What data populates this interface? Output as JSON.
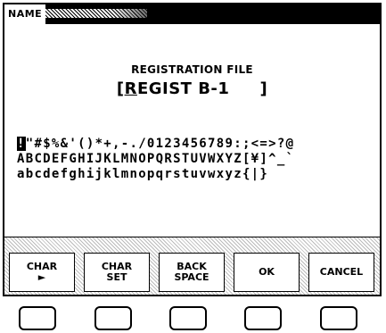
{
  "title": "NAME",
  "label": "REGISTRATION FILE",
  "file_name": {
    "open_bracket": "[",
    "cursor_char": "R",
    "rest": "EGIST B-1",
    "close_bracket": "]"
  },
  "charset": {
    "selected": "!",
    "row1_rest": "\"#$%&'()*+,-./0123456789:;<=>?@",
    "row2": "ABCDEFGHIJKLMNOPQRSTUVWXYZ[¥]^_`",
    "row3": "abcdefghijklmnopqrstuvwxyz{|}"
  },
  "buttons": [
    {
      "line1": "CHAR",
      "line2": "►"
    },
    {
      "line1": "CHAR",
      "line2": "SET"
    },
    {
      "line1": "BACK",
      "line2": "SPACE"
    },
    {
      "line1": "OK",
      "line2": ""
    },
    {
      "line1": "CANCEL",
      "line2": ""
    }
  ]
}
